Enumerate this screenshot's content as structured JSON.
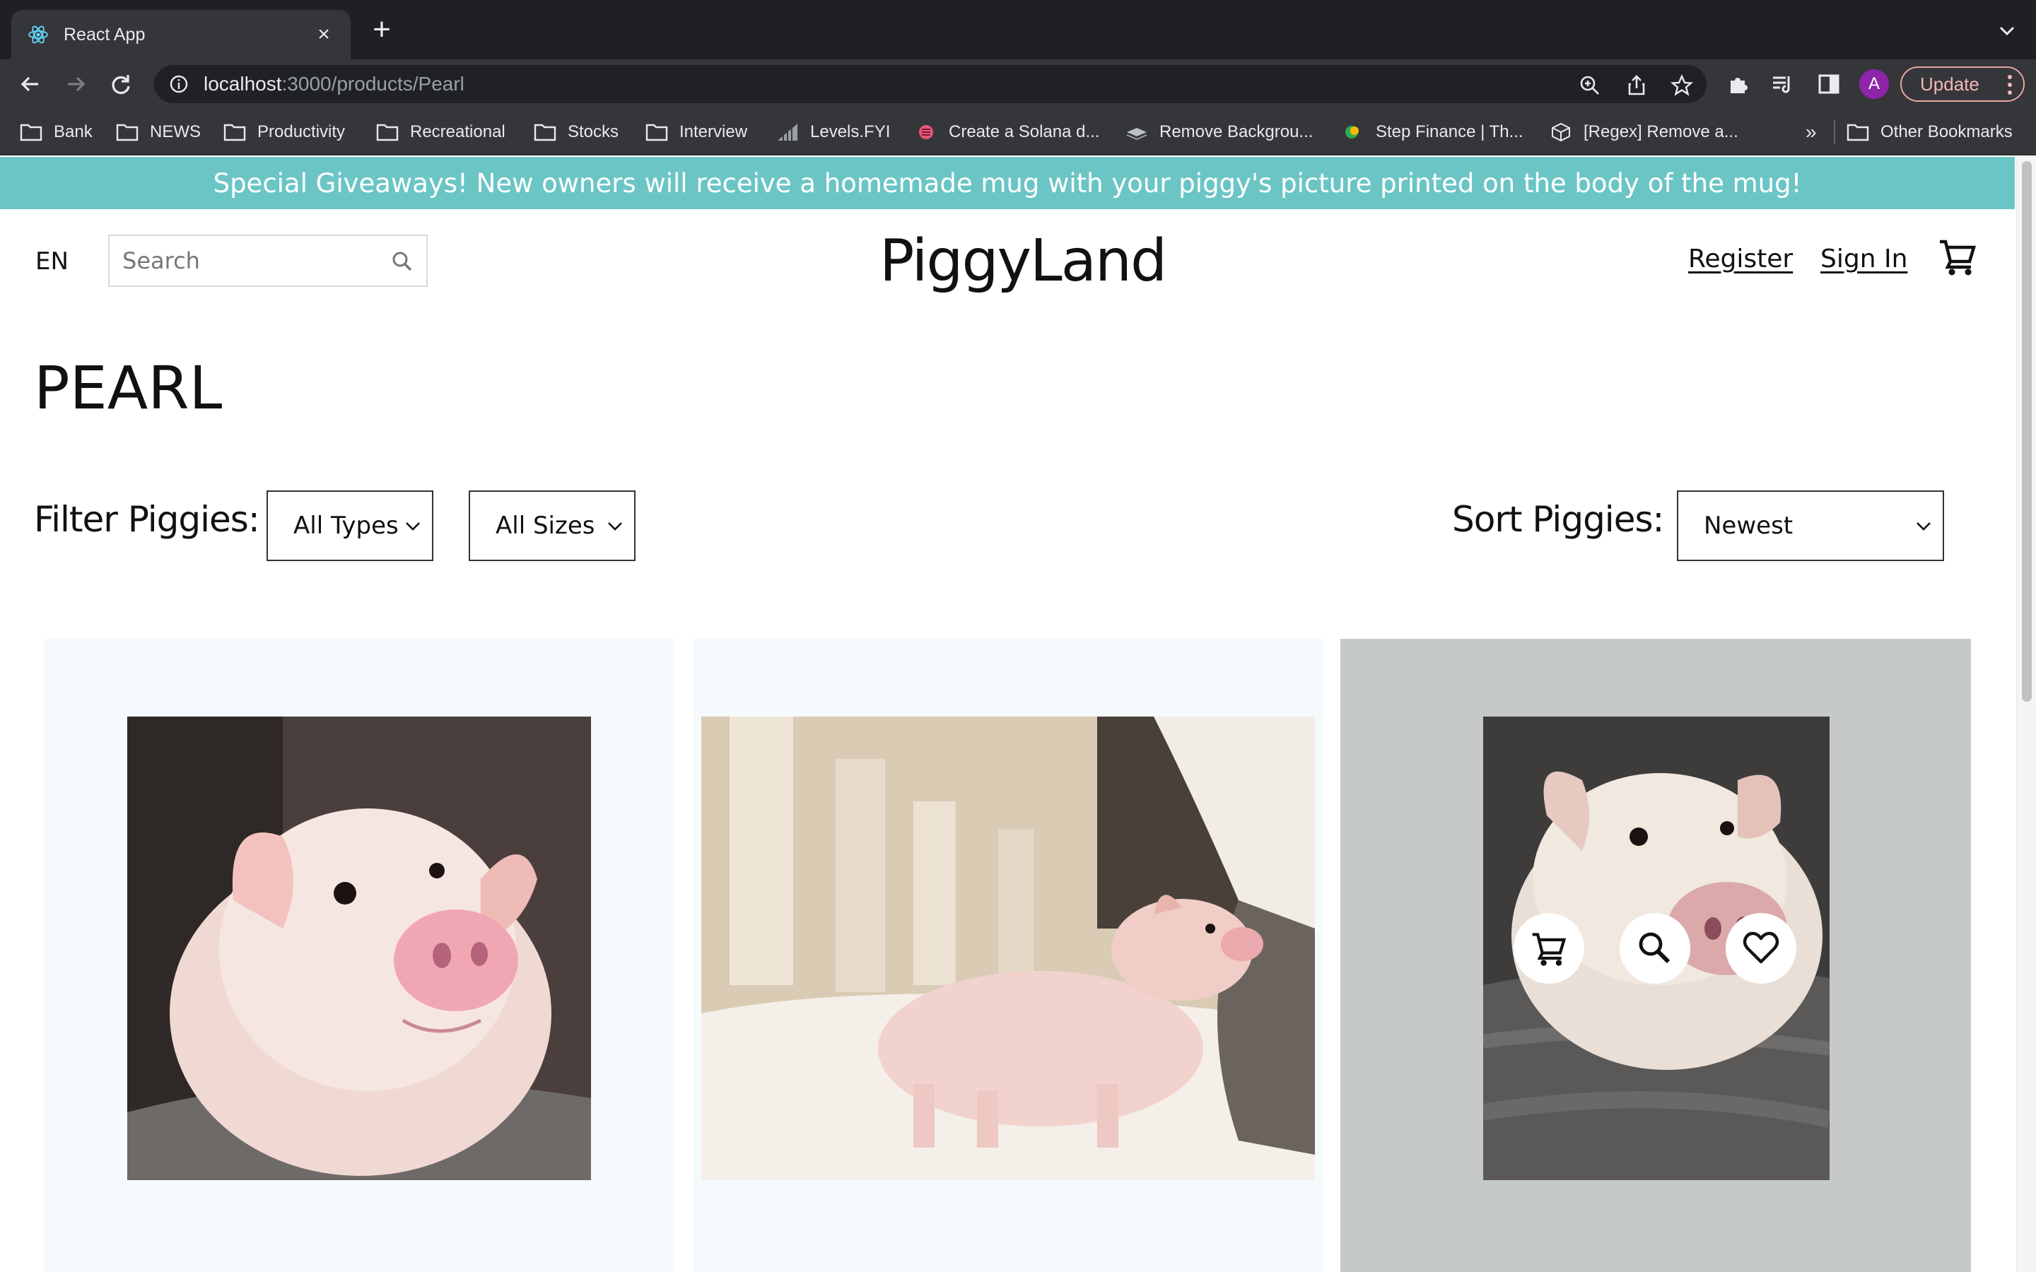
{
  "browser": {
    "tab_title": "React App",
    "url_host": "localhost",
    "url_path": ":3000/products/Pearl",
    "avatar_letter": "A",
    "update_label": "Update",
    "bookmarks": [
      {
        "label": "Bank",
        "icon": "folder-icon"
      },
      {
        "label": "NEWS",
        "icon": "folder-icon"
      },
      {
        "label": "Productivity",
        "icon": "folder-icon"
      },
      {
        "label": "Recreational",
        "icon": "folder-icon"
      },
      {
        "label": "Stocks",
        "icon": "folder-icon"
      },
      {
        "label": "Interview",
        "icon": "folder-icon"
      },
      {
        "label": "Levels.FYI",
        "icon": "levels-fyi-icon"
      },
      {
        "label": "Create a Solana d...",
        "icon": "solana-icon"
      },
      {
        "label": "Remove Backgrou...",
        "icon": "layers-icon"
      },
      {
        "label": "Step Finance | Th...",
        "icon": "step-finance-icon"
      },
      {
        "label": "[Regex] Remove a...",
        "icon": "box-icon"
      }
    ],
    "overflow_label": "»",
    "other_bookmarks": "Other Bookmarks"
  },
  "site": {
    "announcement": "Special Giveaways! New owners will receive a homemade mug with your piggy's picture printed on the body of the mug!",
    "language": "EN",
    "search_placeholder": "Search",
    "logo": "PiggyLand",
    "register": "Register",
    "sign_in": "Sign In",
    "accent_color": "#6cc5c5"
  },
  "main": {
    "title": "PEARL",
    "filter_label": "Filter Piggies:",
    "type_filter": "All Types",
    "size_filter": "All Sizes",
    "sort_label": "Sort Piggies:",
    "sort_value": "Newest"
  },
  "products": [
    {
      "image": "piglet close-up face photo"
    },
    {
      "image": "piglet standing on white fur rug photo"
    },
    {
      "image": "piglet on grey blanket photo",
      "hovered": true,
      "actions": [
        "cart-icon",
        "search-icon",
        "heart-icon"
      ]
    }
  ]
}
